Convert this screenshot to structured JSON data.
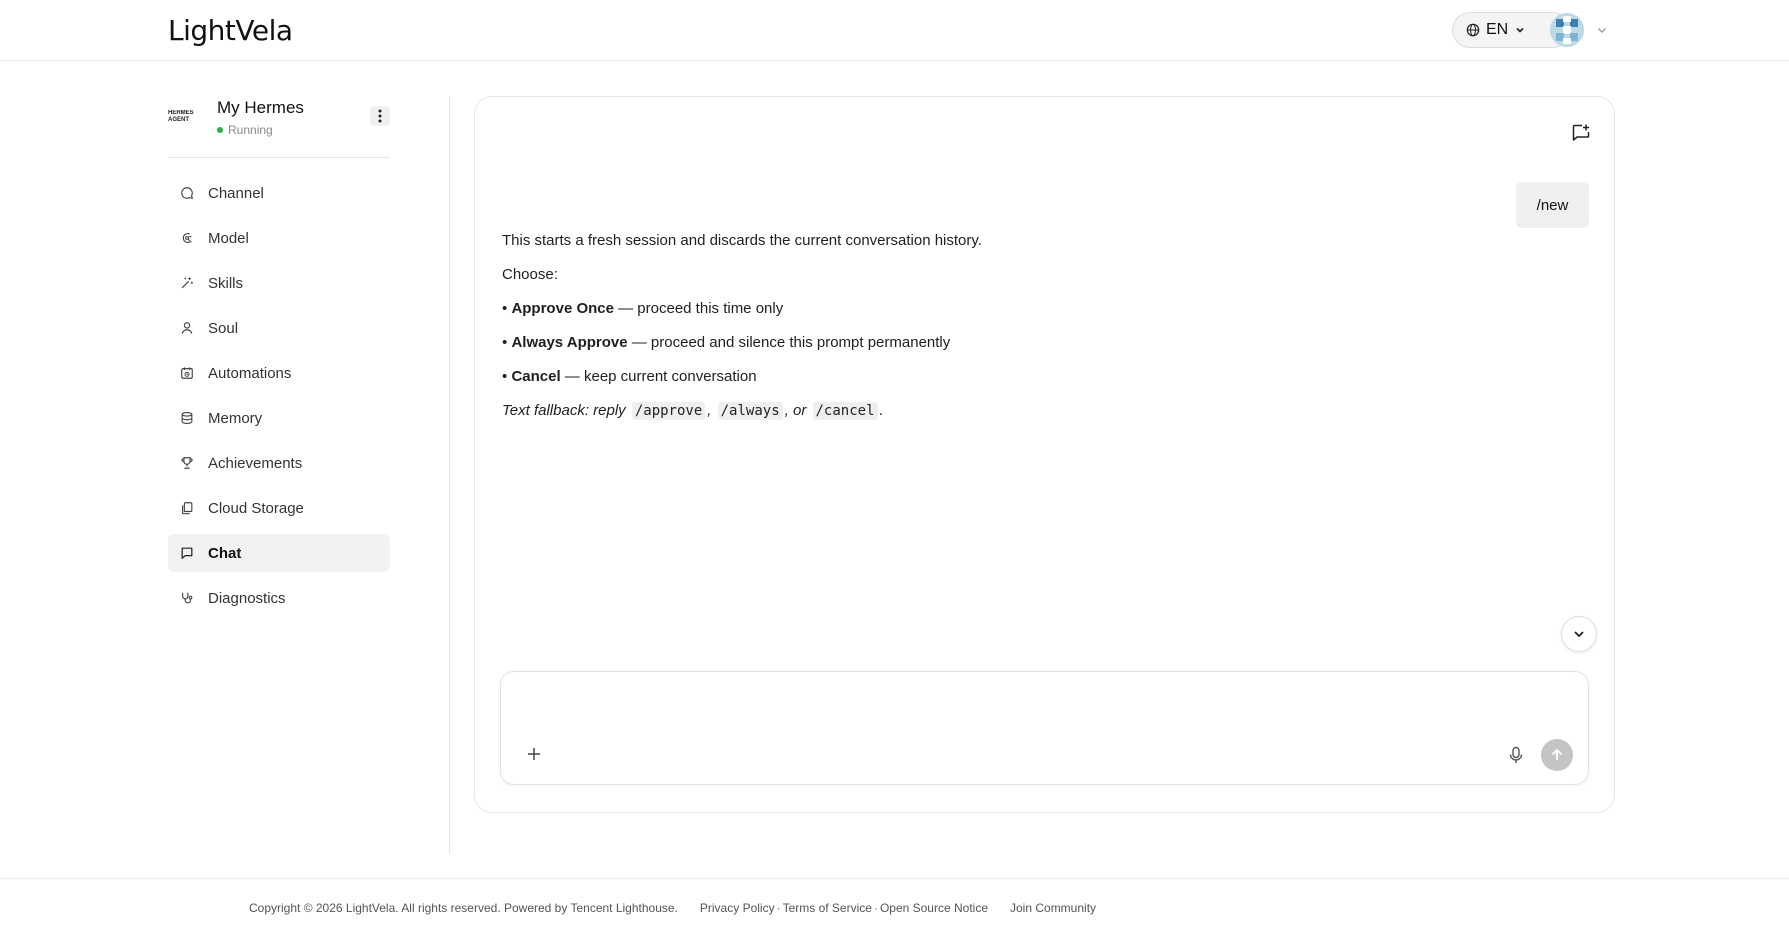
{
  "header": {
    "logo": "LightVela",
    "language": "EN"
  },
  "sidebar": {
    "agent": {
      "name": "My Hermes",
      "status": "Running",
      "thumb_text": "HERMES AGENT"
    },
    "items": [
      {
        "label": "Channel",
        "icon": "message-icon"
      },
      {
        "label": "Model",
        "icon": "model-icon"
      },
      {
        "label": "Skills",
        "icon": "wand-icon"
      },
      {
        "label": "Soul",
        "icon": "person-icon"
      },
      {
        "label": "Automations",
        "icon": "clock-icon"
      },
      {
        "label": "Memory",
        "icon": "database-icon"
      },
      {
        "label": "Achievements",
        "icon": "trophy-icon"
      },
      {
        "label": "Cloud Storage",
        "icon": "copy-icon"
      },
      {
        "label": "Chat",
        "icon": "chat-icon",
        "active": true
      },
      {
        "label": "Diagnostics",
        "icon": "stethoscope-icon"
      }
    ]
  },
  "chat": {
    "user_message": "/new",
    "reply": {
      "intro": "This starts a fresh session and discards the current conversation history.",
      "choose": "Choose:",
      "options": [
        {
          "bullet": "•",
          "title": "Approve Once",
          "desc": " — proceed this time only"
        },
        {
          "bullet": "•",
          "title": "Always Approve",
          "desc": " — proceed and silence this prompt permanently"
        },
        {
          "bullet": "•",
          "title": "Cancel",
          "desc": " — keep current conversation"
        }
      ],
      "fallback_prefix": "Text fallback: reply",
      "fallback_cmd1": "/approve",
      "fallback_sep1": ",",
      "fallback_cmd2": "/always",
      "fallback_sep2": ", or",
      "fallback_cmd3": "/cancel",
      "fallback_end": "."
    },
    "composer": {
      "placeholder": ""
    }
  },
  "footer": {
    "copyright": "Copyright © 2026 LightVela. All rights reserved. Powered by Tencent Lighthouse.",
    "privacy": "Privacy Policy",
    "terms": "Terms of Service",
    "open_source": "Open Source Notice",
    "separator": "·",
    "community": "Join Community"
  },
  "colors": {
    "status_running": "#2bb04a",
    "active_nav_bg": "#f2f2f2",
    "send_disabled": "#c4c4c4"
  }
}
